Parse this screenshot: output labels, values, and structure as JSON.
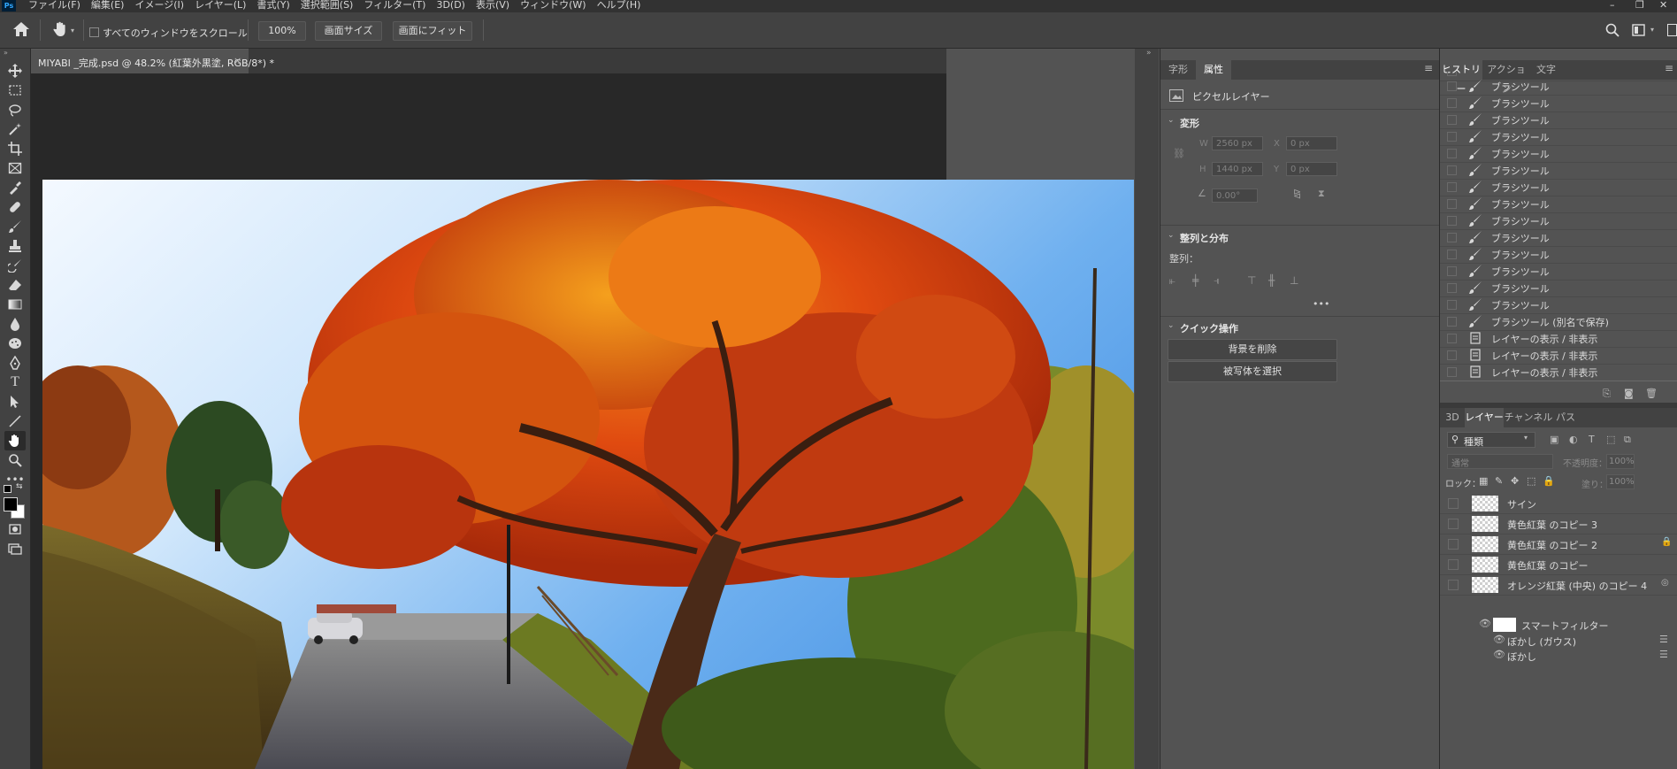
{
  "app": {
    "logo": "Ps"
  },
  "menu": [
    "ファイル(F)",
    "編集(E)",
    "イメージ(I)",
    "レイヤー(L)",
    "書式(Y)",
    "選択範囲(S)",
    "フィルター(T)",
    "3D(D)",
    "表示(V)",
    "ウィンドウ(W)",
    "ヘルプ(H)"
  ],
  "window_controls": {
    "minimize": "–",
    "restore": "❐",
    "close": "✕"
  },
  "options": {
    "scroll_all_label": "すべてのウィンドウをスクロール",
    "zoom_value": "100%",
    "fit_screen_label": "画面サイズ",
    "fill_screen_label": "画面にフィット"
  },
  "document": {
    "tab_title": "MIYABI _完成.psd @ 48.2% (紅葉外黒塗, RGB/8*) *",
    "tab_close": "×"
  },
  "properties": {
    "tabs": [
      "字形",
      "属性"
    ],
    "active_tab": "属性",
    "layer_kind": "ピクセルレイヤー",
    "transform": {
      "title": "変形",
      "w_label": "W",
      "w_value": "2560 px",
      "h_label": "H",
      "h_value": "1440 px",
      "x_label": "X",
      "x_value": "0 px",
      "y_label": "Y",
      "y_value": "0 px",
      "angle_value": "0.00°"
    },
    "align": {
      "title": "整列と分布",
      "label": "整列：",
      "more": "•••"
    },
    "quick": {
      "title": "クイック操作",
      "remove_bg": "背景を削除",
      "select_subject": "被写体を選択"
    }
  },
  "history": {
    "tabs": [
      "ヒストリー",
      "アクション",
      "文字"
    ],
    "active_tab": "ヒストリー",
    "items": [
      {
        "label": "ブラシツール",
        "icon": "brush-icon"
      },
      {
        "label": "ブラシツール",
        "icon": "brush-icon"
      },
      {
        "label": "ブラシツール",
        "icon": "brush-icon"
      },
      {
        "label": "ブラシツール",
        "icon": "brush-icon"
      },
      {
        "label": "ブラシツール",
        "icon": "brush-icon"
      },
      {
        "label": "ブラシツール",
        "icon": "brush-icon"
      },
      {
        "label": "ブラシツール",
        "icon": "brush-icon"
      },
      {
        "label": "ブラシツール",
        "icon": "brush-icon"
      },
      {
        "label": "ブラシツール",
        "icon": "brush-icon"
      },
      {
        "label": "ブラシツール",
        "icon": "brush-icon"
      },
      {
        "label": "ブラシツール",
        "icon": "brush-icon"
      },
      {
        "label": "ブラシツール",
        "icon": "brush-icon"
      },
      {
        "label": "ブラシツール",
        "icon": "brush-icon"
      },
      {
        "label": "ブラシツール",
        "icon": "brush-icon"
      },
      {
        "label": "ブラシツール (別名で保存)",
        "icon": "brush-icon"
      },
      {
        "label": "レイヤーの表示 / 非表示",
        "icon": "document-icon"
      },
      {
        "label": "レイヤーの表示 / 非表示",
        "icon": "document-icon"
      },
      {
        "label": "レイヤーの表示 / 非表示",
        "icon": "document-icon"
      },
      {
        "label": "レイヤーの表示 / 非表示",
        "icon": "document-icon"
      }
    ]
  },
  "layers": {
    "tabs": [
      "3D",
      "レイヤー",
      "チャンネル",
      "パス"
    ],
    "active_tab": "レイヤー",
    "filter_kind": "種類",
    "blend_mode": "通常",
    "opacity_label": "不透明度：",
    "opacity_value": "100%",
    "lock_label": "ロック：",
    "fill_label": "塗り：",
    "fill_value": "100%",
    "items": [
      {
        "name": "サイン"
      },
      {
        "name": "黄色紅葉 のコピー 3"
      },
      {
        "name": "黄色紅葉 のコピー 2"
      },
      {
        "name": "黄色紅葉 のコピー"
      },
      {
        "name": "オレンジ紅葉 (中央) のコピー 4"
      }
    ],
    "smart_filter_label": "スマートフィルター",
    "filters": [
      "ぼかし (ガウス)",
      "ぼかし"
    ]
  },
  "colors": {
    "accent": "#31a8ff",
    "panel": "#535353",
    "toolbar": "#424242",
    "selected_row": "#6a6a6a"
  }
}
